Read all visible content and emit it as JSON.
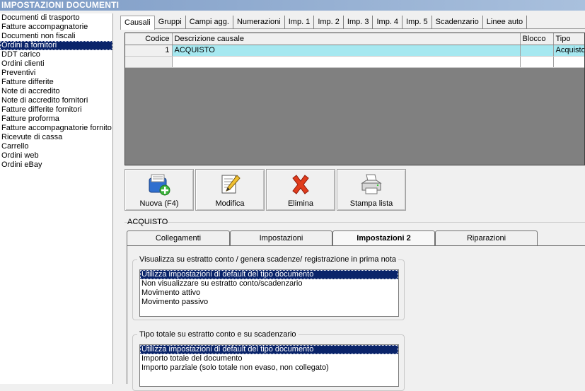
{
  "window": {
    "title": "IMPOSTAZIONI DOCUMENTI"
  },
  "doc_types": {
    "items": [
      "Documenti di trasporto",
      "Fatture accompagnatorie",
      "Documenti non fiscali",
      "Ordini a fornitori",
      "DDT carico",
      "Ordini clienti",
      "Preventivi",
      "Fatture differite",
      "Note di accredito",
      "Note di accredito fornitori",
      "Fatture differite fornitori",
      "Fatture proforma",
      "Fatture accompagnatorie fornito",
      "Ricevute di cassa",
      "Carrello",
      "Ordini web",
      "Ordini eBay"
    ],
    "selected": "Ordini a fornitori"
  },
  "tabs": [
    "Causali",
    "Gruppi",
    "Campi agg.",
    "Numerazioni",
    "Imp. 1",
    "Imp. 2",
    "Imp. 3",
    "Imp. 4",
    "Imp. 5",
    "Scadenzario",
    "Linee auto"
  ],
  "active_tab": "Causali",
  "grid": {
    "headers": {
      "codice": "Codice",
      "descrizione": "Descrizione causale",
      "blocco": "Blocco",
      "tipo": "Tipo"
    },
    "rows": [
      {
        "codice": "1",
        "descrizione": "ACQUISTO",
        "blocco": "",
        "tipo": "Acquisto"
      }
    ]
  },
  "buttons": {
    "nuova": "Nuova (F4)",
    "modifica": "Modifica",
    "elimina": "Elimina",
    "stampa": "Stampa lista"
  },
  "detail": {
    "group_title": "ACQUISTO",
    "subtabs": [
      "Collegamenti",
      "Impostazioni",
      "Impostazioni 2",
      "Riparazioni"
    ],
    "active_subtab": "Impostazioni 2",
    "fieldset1": {
      "legend": "Visualizza su estratto conto / genera scadenze/ registrazione  in prima nota",
      "options": [
        "Utilizza impostazioni di default del tipo documento",
        "Non visualizzare su estratto conto/scadenzario",
        "Movimento attivo",
        "Movimento passivo"
      ],
      "selected": "Utilizza impostazioni di default del tipo documento"
    },
    "fieldset2": {
      "legend": "Tipo totale su estratto conto e su scadenzario",
      "options": [
        "Utilizza impostazioni di default del tipo documento",
        "Importo totale del documento",
        "Importo parziale (solo totale non evaso, non collegato)"
      ],
      "selected": "Utilizza impostazioni di default del tipo documento"
    }
  }
}
